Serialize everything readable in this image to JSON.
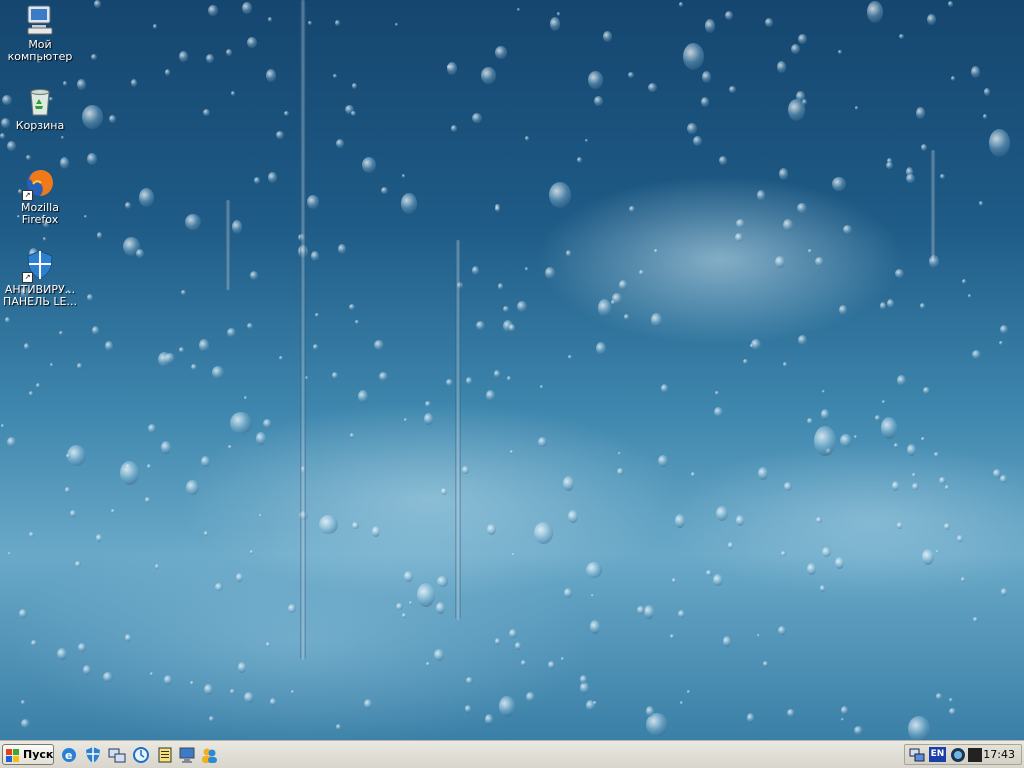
{
  "desktop": {
    "icons": [
      {
        "label": "Мой компьютер",
        "icon": "my-computer-icon"
      },
      {
        "label": "Корзина",
        "icon": "recycle-bin-icon"
      },
      {
        "label": "Mozilla Firefox",
        "icon": "firefox-icon"
      },
      {
        "label": "АНТИВИРУ... ПАНЕЛЬ LE...",
        "icon": "antivirus-shield-icon"
      }
    ],
    "colors": {
      "wallpaper_top": "#15466f",
      "wallpaper_mid": "#3e86ad",
      "wallpaper_light": "#6aa9c8"
    }
  },
  "taskbar": {
    "start_label": "Пуск",
    "quick_launch": [
      "ie-icon",
      "security-shield-icon",
      "network-icon",
      "update-icon",
      "notepad-icon",
      "monitor-icon",
      "messenger-icon"
    ],
    "tray": {
      "icons": [
        "network-tray-icon",
        "sound-tray-icon",
        "app-tray-icon"
      ],
      "language": "EN",
      "clock": "17:43"
    }
  }
}
